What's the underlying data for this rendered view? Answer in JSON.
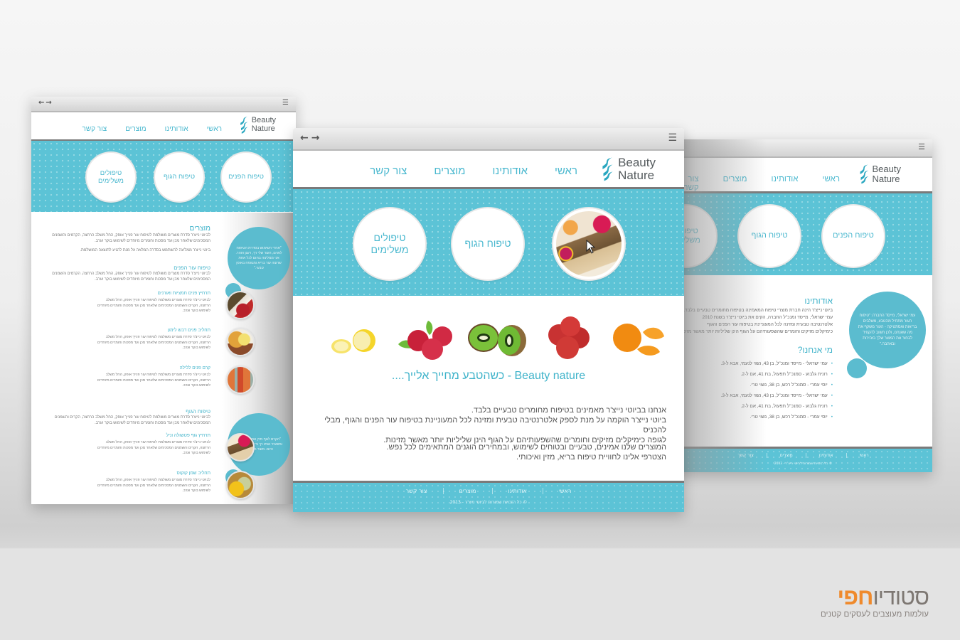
{
  "site": {
    "logo": {
      "line1": "Beauty",
      "line2": "Nature"
    },
    "nav": [
      "ראשי",
      "אודותינו",
      "מוצרים",
      "צור קשר"
    ],
    "treatments": [
      "טיפוח הפנים",
      "טיפוח הגוף",
      "טיפולים משלימים"
    ],
    "footer": {
      "links": [
        "ראשי",
        "אודותינו",
        "מוצרים",
        "צור קשר"
      ],
      "copyright": "© כל הזכויות שמורות לביוטי נייצ'ר - 2013"
    },
    "colors": {
      "accent": "#5cc3d6",
      "link": "#4ab8cf",
      "text": "#555555"
    }
  },
  "browser": {
    "back_icon": "←",
    "forward_icon": "→",
    "menu_icon": "☰"
  },
  "center_page": {
    "fruits": [
      "lemon",
      "raspberries",
      "kiwi",
      "strawberries",
      "orange"
    ],
    "slogan": "Beauty nature - כשהטבע מחייך אלייך....",
    "paragraph1": [
      "אנחנו בביוטי נייצ'ר מאמינים בטיפוח מחומרים טבעיים בלבד.",
      "ביוטי נייצ'ר הוקמה על מנת לספק אלטרנטיבה טבעית ומזינה לכל המעוניינת בטיפוח עור הפנים והגוף, מבלי להכניס",
      "לגופה כימיקלים מזיקים וחומרים שהשפעותיהם על הגוף הינן שליליות יותר מאשר מזינות."
    ],
    "paragraph2": [
      "המוצרים שלנו אמינים, טבעיים ובטוחים לשימוש, ובמחירים הוגנים המתאימים לכל נפש.",
      "הצטרפי אלינו לחוויית טיפוח בריא, מזין ואיכותי."
    ]
  },
  "left_page": {
    "products": {
      "title": "מוצרים",
      "text": "לביוטי נייצ'ר סדרת מוצרים משולמת לטיפוח עור פנייך אופק, החל משלב הרחצה, הקרמים והשמנים המסכימים שלאחר מכן ועד מסכות וחומרים מיוחדים לשימוש בוקר וערב.",
      "note": "ביוטי נייצ'ר ממליצה להשתמש בסדרה המלאה על מנת להגיע לתוצאה המושלמת."
    },
    "face": {
      "title": "טיפוח עור הפנים",
      "text": "לביוטי נייצ'ר סדרת מוצרים משולמת לטיפוח עור פנייך אופק, החל משלב הרחצה, הקרמים והשמנים המסכימים שלאחר מכן ועד מסכות וחומרים מיוחדים לשימוש בוקר וערב.",
      "items": [
        {
          "title": "תרחיץ פנים חמציות ואורנים",
          "text": "לביוטי נייצ'ר סדרת מוצרים משולמת לטיפוח עור פנייך אופק, החל משלב הרחצה, הקרים והשמנים המסכימים שלאחר מכן ועד מסכות וחומרים מיוחדים לשימוש בוקר וערב."
        },
        {
          "title": "תחליב פנים דבש לימון",
          "text": "לביוטי נייצ'ר סדרת מוצרים משולמת לטיפוח עור פנייך אופק, החל משלב הרחצה, הקרים והשמנים המסכימים שלאחר מכן ועד מסכות וחומרים מיוחדים לשימוש בוקר וערב."
        },
        {
          "title": "קרם פנים ללילה",
          "text": "לביוטי נייצ'ר סדרת מוצרים משולמת לטיפוח עור פנייך אופק, החל משלב הרחצה, הקרים והשמנים המסכימים שלאחר מכן ועד מסכות וחומרים מיוחדים לשימוש בוקר וערב."
        }
      ]
    },
    "body": {
      "title": "טיפוח הגוף",
      "text": "לביוטי נייצ'ר סדרת מוצרים משולמת לטיפוח עור פנייך אופק, החל משלב הרחצה, הקרים והשמנים המסכימים שלאחר מכן ועד מסכות וחומרים מיוחדים לשימוש בוקר וערב.",
      "items": [
        {
          "title": "תרחיץ גוף פטשולה וניל",
          "text": "לביוטי נייצ'ר סדרת מוצרים משולמת לטיפוח עור פנייך אופק, החל משלב הרחצה, הקרים והשמנים המסכימים שלאחר מכן ועד מסכות וחומרים מיוחדים לשימוש בוקר וערב."
        },
        {
          "title": "תחליב שמן קוקוס",
          "text": "לביוטי נייצ'ר סדרת מוצרים משולמת לטיפוח עור פנייך אופק, החל משלב הרחצה, הקרים והשמנים המסכימים שלאחר מכן ועד מסכות וחומרים מיוחדים לשימוש בוקר וערב."
        }
      ]
    },
    "quote1": "\"אחרי השימוש בסדרת הטיפוח לפנים, העור שלי רך, רענן וזוהר. אני ממליצה בחום לכל אחת שרוצה עור בריא ומטופח באופן טבעי.\"",
    "quote2": "\"הקרם לגוף מזין את העור שלי ומשאיר אותו רך וריחני לאורך כל היום. מוצר מעולה!\""
  },
  "right_page": {
    "about": {
      "title": "אודותינו",
      "lines": [
        "ביוטי נייצ'ר הינה חברת מוצרי טיפוח המאמינה בטיפוח מחומרים טבעיים בלבד.",
        "עמי ישראלי, מייסד ומנכ\"ל החברה, הקים את ביוטי נייצ'ר בשנת 2010",
        "אלטרנטיבה טבעית ומזינה לכל המעוניינת בטיפוח עור הפנים והגוף",
        "כימיקלים מזיקים וחומרים שהשפעותיהם על הגוף הינן שליליות יותר מאשר מזינות."
      ]
    },
    "team": {
      "title": "מי אנחנו?",
      "members": [
        "עמי ישראלי - מייסד ומנכ\"ל, בן 43, נשוי לנעמי, אבא ל-3.",
        "רונית גלבוע - סמנכ\"ל תפעול, בת 41, אם ל-2.",
        "יוסי עמרי - סמנכ\"ל רכש, בן 38, נשוי טרי.",
        "עמי ישראלי - מייסד ומנכ\"ל, בן 43, נשוי לנעמי, אבא ל-3.",
        "רונית גלבוע - סמנכ\"ל תפעול, בת 41, אם ל-2.",
        "יוסי עמרי - סמנכ\"ל רכש, בן 38, נשוי טרי."
      ]
    },
    "quote": "עמי ישראלי, מייסד החברה: \"טיפוח העור מתחיל מהטבע, משלבים בריאות ואסתטיקה - העור משקף את מה שאנחנו, ולכן חשוב להקפיד לבחור את המוצר שלך בזהירות ובאהבה.\""
  },
  "brand": {
    "name_plain": "סטודיו",
    "name_accent": "חפי",
    "tagline": "עולמות מעוצבים לעסקים קטנים",
    "accent_color": "#ef8a2c"
  }
}
